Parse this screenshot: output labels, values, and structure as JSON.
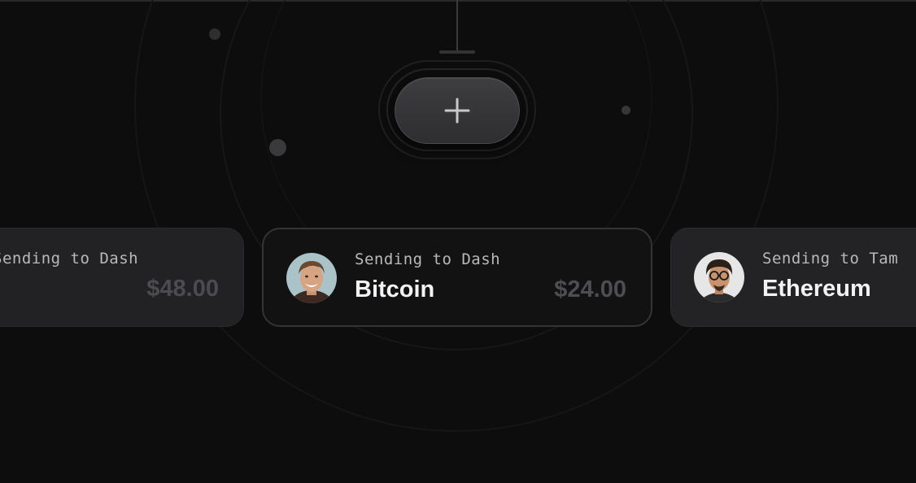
{
  "add_button": {
    "icon": "plus-icon"
  },
  "cards": [
    {
      "sending_label": "Sending to Dash",
      "coin": "",
      "amount": "$48.00"
    },
    {
      "sending_label": "Sending to Dash",
      "coin": "Bitcoin",
      "amount": "$24.00",
      "avatar": "smiling-man-avatar"
    },
    {
      "sending_label": "Sending to Tam",
      "coin": "Ethereum",
      "amount": "",
      "avatar": "man-with-glasses-avatar"
    }
  ],
  "colors": {
    "background": "#0d0d0e",
    "card_center_bg": "#121213",
    "card_side_bg": "#222224",
    "amount_text": "#4e4e52",
    "title_text": "#f2f2f4"
  }
}
